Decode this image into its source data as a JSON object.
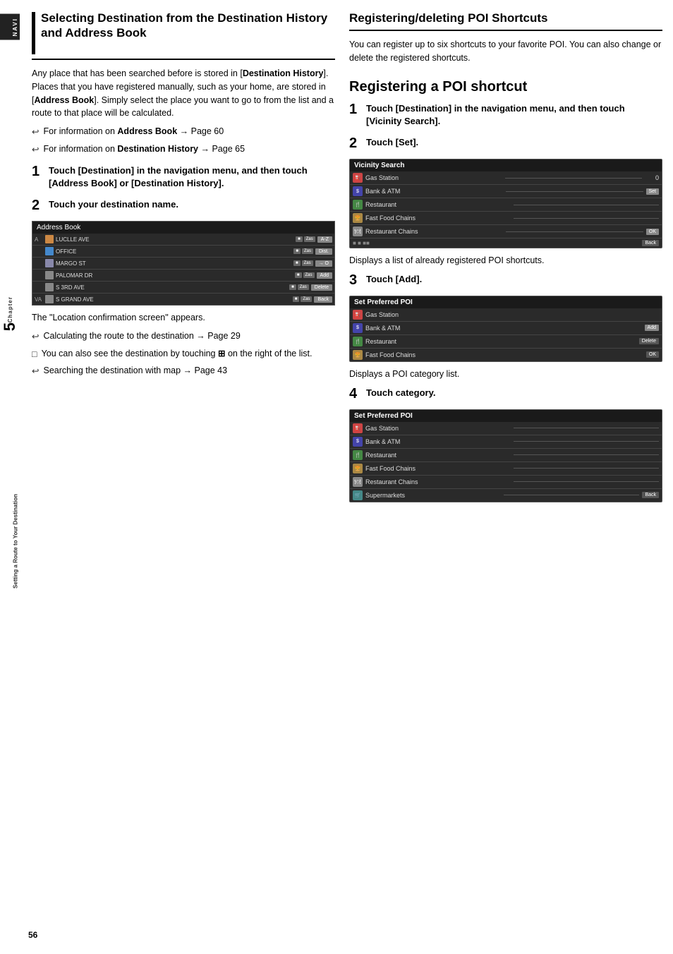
{
  "sidebar": {
    "navi_label": "NAVI",
    "chapter_label": "Chapter",
    "chapter_number": "5",
    "dest_label": "Setting a Route to Your Destination"
  },
  "left": {
    "section_title": "Selecting Destination from the Destination History and Address Book",
    "intro_para": "Any place that has been searched before is stored in [Destination History]. Places that you have registered manually, such as your home, are stored in [Address Book]. Simply select the place you want to go to from the list and a route to that place will be calculated.",
    "bullet1": "For information on Address Book → Page 60",
    "bullet2": "For information on Destination History → Page 65",
    "step1_text": "Touch [Destination] in the navigation menu, and then touch [Address Book] or [Destination History].",
    "step2_text": "Touch your destination name.",
    "address_book_label": "Address Book",
    "ab_rows": [
      {
        "letter": "A",
        "name": "LUCLLE AVE",
        "btn1": "■",
        "btn2": "Zas",
        "btn3": "A-Z"
      },
      {
        "letter": "",
        "name": "OFFICE",
        "btn1": "■",
        "btn2": "Zas",
        "btn3": "Dist."
      },
      {
        "letter": "",
        "name": "MARGO ST",
        "btn1": "■",
        "btn2": "Zas",
        "btn3": "→ O"
      },
      {
        "letter": "",
        "name": "PALOMAR DR",
        "btn1": "■",
        "btn2": "Zas",
        "btn3": "Add"
      },
      {
        "letter": "",
        "name": "S 3RD AVE",
        "btn1": "■",
        "btn2": "Zas",
        "btn3": "Delete"
      },
      {
        "letter": "VA",
        "name": "S GRAND AVE",
        "btn1": "■",
        "btn2": "Zas",
        "btn3": "Back"
      }
    ],
    "confirmation_text": "The \"Location confirmation screen\" appears.",
    "sub_bullet1": "Calculating the route to the destination → Page 29",
    "sub_bullet2": "You can also see the destination by touching [icon] on the right of the list.",
    "sub_bullet3": "Searching the destination with map → Page 43"
  },
  "right": {
    "section_title": "Registering/deleting POI Shortcuts",
    "intro_para": "You can register up to six shortcuts to your favorite POI. You can also change or delete the registered shortcuts.",
    "subsection1_title": "Registering a POI shortcut",
    "step1_text": "Touch [Destination] in the navigation menu, and then touch [Vicinity Search].",
    "step2_text": "Touch [Set].",
    "vicinity_search_label": "Vicinity Search",
    "vicinity_rows": [
      {
        "icon": "gas",
        "label": "Gas Station",
        "dash": true,
        "num": "0"
      },
      {
        "icon": "bank",
        "label": "Bank & ATM",
        "dash": true,
        "btn": "Set"
      },
      {
        "icon": "restaurant",
        "label": "Restaurant",
        "dash": true
      },
      {
        "icon": "fast-food",
        "label": "Fast Food Chains",
        "dash": true
      },
      {
        "icon": "rest-chain",
        "label": "Restaurant Chains",
        "dash": true,
        "btn": "OK"
      },
      {
        "icon": "",
        "label": "",
        "dash": false,
        "btn": "Back"
      }
    ],
    "vicinity_caption": "Displays a list of already registered POI shortcuts.",
    "step3_text": "Touch [Add].",
    "set_preferred_poi1_label": "Set Preferred POI",
    "preferred_rows1": [
      {
        "icon": "gas",
        "label": "Gas Station"
      },
      {
        "icon": "bank",
        "label": "Bank & ATM"
      },
      {
        "icon": "restaurant",
        "label": "Restaurant"
      },
      {
        "icon": "fast-food",
        "label": "Fast Food Chains"
      }
    ],
    "preferred_btns1": [
      "Add",
      "Delete",
      "OK"
    ],
    "preferred_caption1": "Displays a POI category list.",
    "step4_text": "Touch category.",
    "set_preferred_poi2_label": "Set Preferred POI",
    "preferred_rows2": [
      {
        "icon": "gas",
        "label": "Gas Station"
      },
      {
        "icon": "bank",
        "label": "Bank & ATM"
      },
      {
        "icon": "restaurant",
        "label": "Restaurant"
      },
      {
        "icon": "fast-food",
        "label": "Fast Food Chains"
      },
      {
        "icon": "rest-chain",
        "label": "Restaurant Chains"
      },
      {
        "icon": "super",
        "label": "Supermarkets"
      }
    ],
    "preferred_btn2": "Back"
  },
  "page_number": "56"
}
